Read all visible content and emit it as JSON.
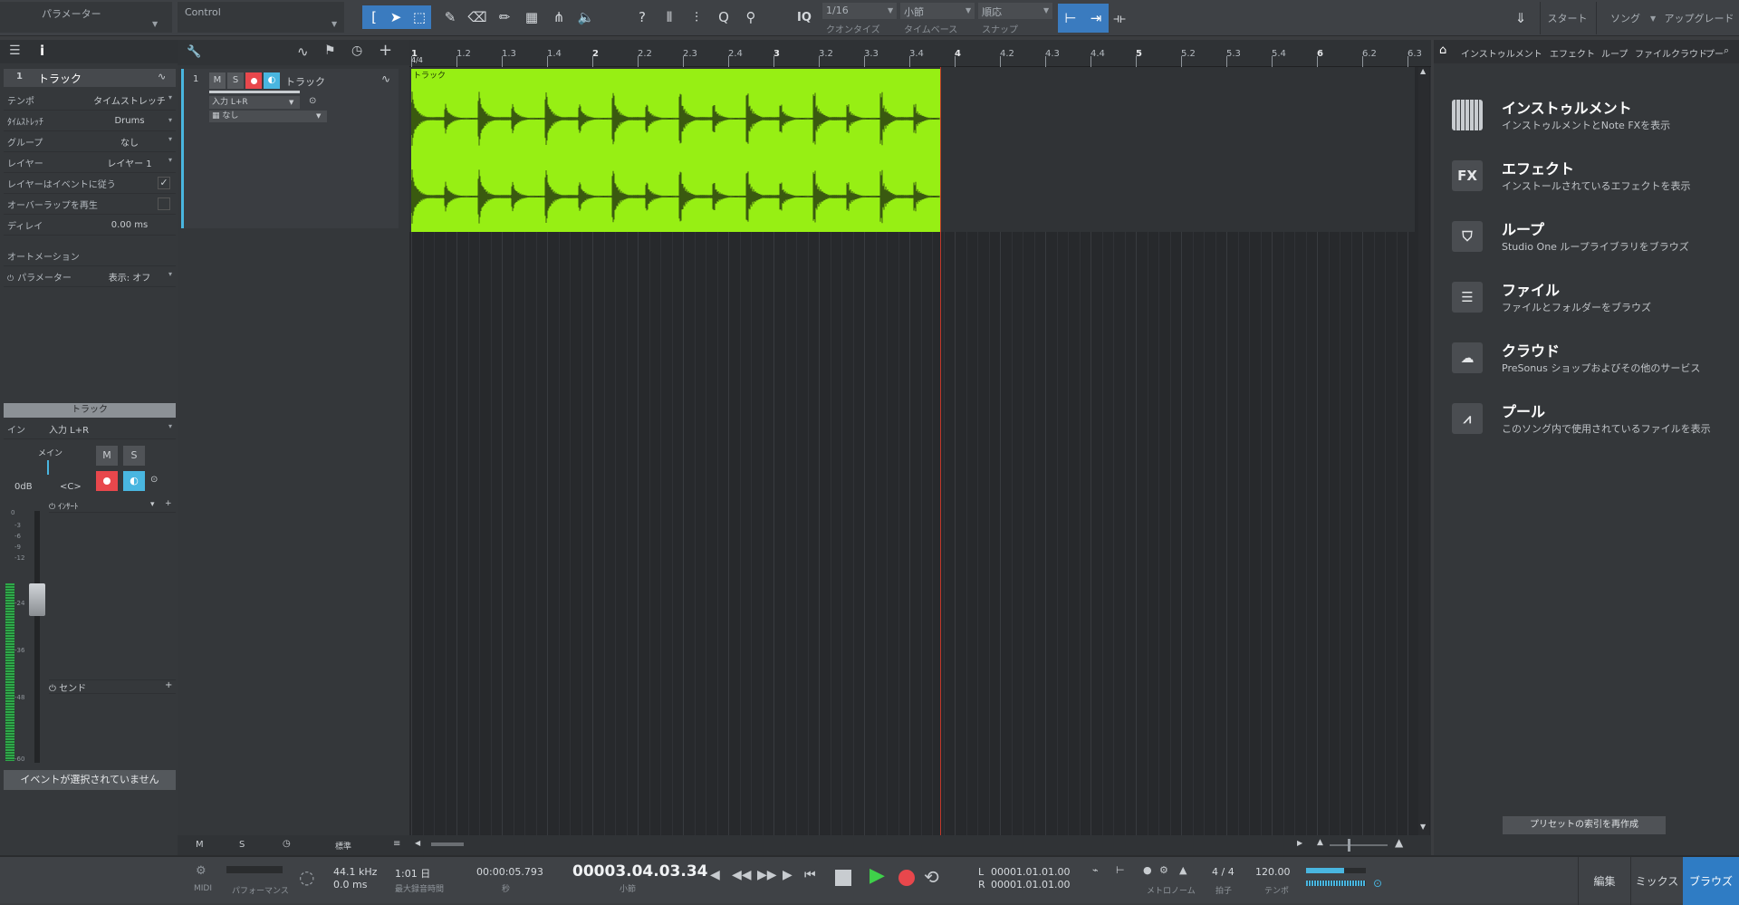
{
  "toolbar": {
    "param_label": "パラメーター",
    "control_label": "Control",
    "iq_label": "IQ",
    "quantize_value": "1/16",
    "quantize_label": "クオンタイズ",
    "timebase_value": "小節",
    "timebase_label": "タイムベース",
    "snap_value": "順応",
    "snap_label": "スナップ",
    "start_label": "スタート",
    "song_label": "ソング",
    "upgrade_label": "アップグレード"
  },
  "inspector": {
    "track_number": "1",
    "track_name": "トラック",
    "rows": [
      {
        "key": "テンポ",
        "value": "タイムストレッチ"
      },
      {
        "key": "ﾀｲﾑｽﾄﾚｯﾁ",
        "value": "Drums"
      },
      {
        "key": "グループ",
        "value": "なし"
      },
      {
        "key": "レイヤー",
        "value": "レイヤー 1"
      }
    ],
    "layers_follow": "レイヤーはイベントに従う",
    "overlap_play": "オーバーラップを再生",
    "delay_key": "ディレイ",
    "delay_value": "0.00 ms",
    "automation_label": "オートメーション",
    "param_key": "パラメーター",
    "param_value": "表示: オフ",
    "channel_title": "トラック",
    "input_key": "イン",
    "input_value": "入力 L+R",
    "main_label": "メイン",
    "mute": "M",
    "solo": "S",
    "gain": "0dB",
    "pan": "<C>",
    "inserts_label": "ｲﾝｻｰﾄ",
    "sends_label": "センド",
    "meter_scale": [
      "0",
      "-3",
      "-6",
      "-9",
      "-12",
      "-24",
      "-36",
      "-48",
      "-60"
    ],
    "no_event": "イベントが選択されていません"
  },
  "track": {
    "number": "1",
    "mute": "M",
    "solo": "S",
    "name": "トラック",
    "input": "入力 L+R",
    "sub": "なし",
    "event_name": "トラック",
    "time_sig": "4/4"
  },
  "ruler": [
    "1",
    "1.2",
    "1.3",
    "1.4",
    "2",
    "2.2",
    "2.3",
    "2.4",
    "3",
    "3.2",
    "3.3",
    "3.4",
    "4",
    "4.2",
    "4.3",
    "4.4",
    "5",
    "5.2",
    "5.3",
    "5.4",
    "6",
    "6.2",
    "6.3"
  ],
  "arrange_footer": {
    "mute": "M",
    "solo": "S",
    "mode": "標準"
  },
  "browser": {
    "tabs": [
      "インストゥルメント",
      "エフェクト",
      "ループ",
      "ファイル",
      "クラウド",
      "プー"
    ],
    "items": [
      {
        "icon": "piano-icon",
        "title": "インストゥルメント",
        "desc": "インストゥルメントとNote FXを表示"
      },
      {
        "icon": "fx-icon",
        "glyph": "FX",
        "title": "エフェクト",
        "desc": "インストールされているエフェクトを表示"
      },
      {
        "icon": "loop-icon",
        "title": "ループ",
        "desc": "Studio One ループライブラリをブラウズ"
      },
      {
        "icon": "file-icon",
        "title": "ファイル",
        "desc": "ファイルとフォルダーをブラウズ"
      },
      {
        "icon": "cloud-icon",
        "title": "クラウド",
        "desc": "PreSonus ショップおよびその他のサービス"
      },
      {
        "icon": "pool-icon",
        "title": "プール",
        "desc": "このソング内で使用されているファイルを表示"
      }
    ],
    "rebuild_button": "プリセットの索引を再作成"
  },
  "transport": {
    "midi": "MIDI",
    "performance": "パフォーマンス",
    "sample_rate": "44.1 kHz",
    "latency": "0.0 ms",
    "rec_days": "1:01 日",
    "rec_max_label": "最大録音時間",
    "time_seconds": "00:00:05.793",
    "seconds_label": "秒",
    "bars_time": "00003.04.03.34",
    "bars_label": "小節",
    "loop_l_label": "L",
    "loop_l": "00001.01.01.00",
    "loop_r_label": "R",
    "loop_r": "00001.01.01.00",
    "metronome_label": "メトロノーム",
    "time_sig": "4 / 4",
    "time_sig_label": "拍子",
    "tempo": "120.00",
    "tempo_label": "テンポ",
    "edit_tab": "編集",
    "mix_tab": "ミックス",
    "browse_tab": "ブラウズ"
  },
  "colors": {
    "event_green": "#97ef14",
    "waveform": "#3a5a10",
    "record_red": "#e8474c",
    "monitor_blue": "#49b6e0",
    "accent_blue": "#2f7cc4",
    "playhead": "#c0392b"
  }
}
